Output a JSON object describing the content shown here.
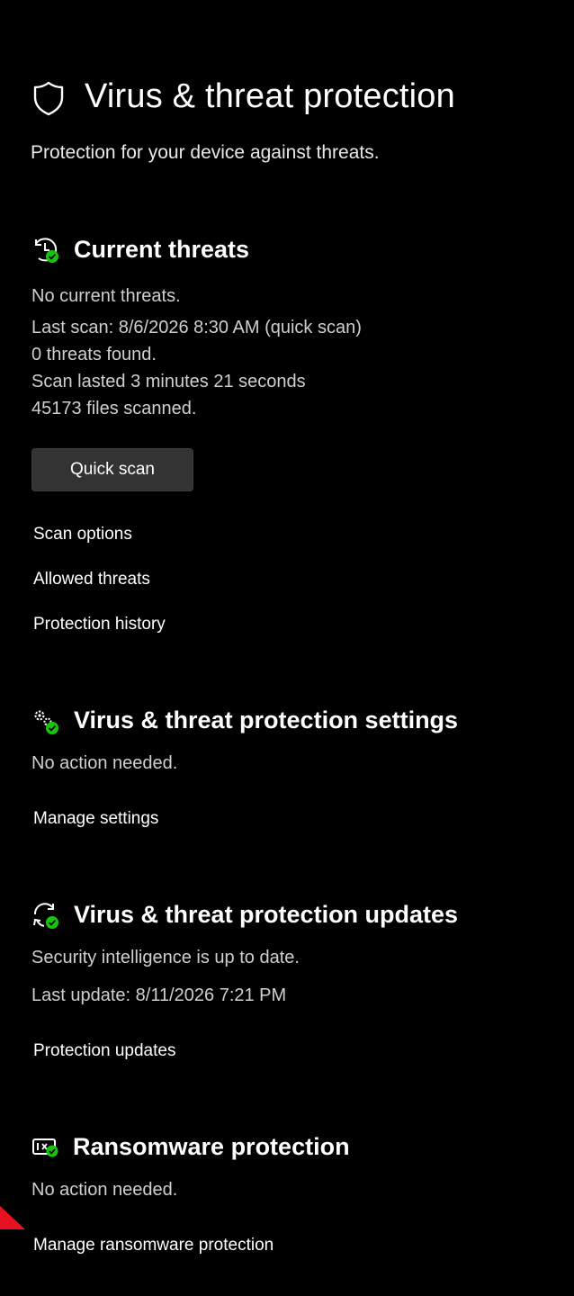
{
  "page": {
    "title": "Virus & threat protection",
    "subtitle": "Protection for your device against threats.",
    "icon": "shield-icon"
  },
  "current_threats": {
    "heading": "Current threats",
    "icon": "clock-check-icon",
    "status": "No current threats.",
    "last_scan": "Last scan: 8/6/2026 8:30 AM (quick scan)",
    "threats_found": "0 threats found.",
    "duration": "Scan lasted 3 minutes 21 seconds",
    "files_scanned": "45173 files scanned.",
    "quick_scan_label": "Quick scan",
    "links": [
      "Scan options",
      "Allowed threats",
      "Protection history"
    ]
  },
  "settings": {
    "heading": "Virus & threat protection settings",
    "icon": "gears-check-icon",
    "status": "No action needed.",
    "link": "Manage settings"
  },
  "updates": {
    "heading": "Virus & threat protection updates",
    "icon": "refresh-check-icon",
    "status": "Security intelligence is up to date.",
    "last_update": "Last update: 8/11/2026 7:21 PM",
    "link": "Protection updates"
  },
  "ransomware": {
    "heading": "Ransomware protection",
    "icon": "ransomware-check-icon",
    "status": "No action needed.",
    "link": "Manage ransomware protection"
  },
  "colors": {
    "background": "#000000",
    "text": "#ffffff",
    "secondary_text": "#cfcfcf",
    "button": "#333333",
    "check_badge": "#16c60c",
    "annotation_arrow": "#e81123"
  }
}
